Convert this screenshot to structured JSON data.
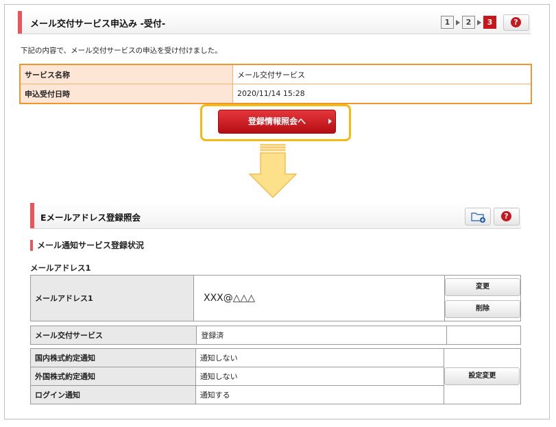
{
  "header": {
    "title": "メール交付サービス申込み -受付-",
    "steps": [
      "1",
      "2",
      "3"
    ],
    "active_step": 3,
    "help_label": "?"
  },
  "intro_text": "下記の内容で、メール交付サービスの申込を受け付けました。",
  "summary": {
    "rows": [
      {
        "label": "サービス名称",
        "value": "メール交付サービス"
      },
      {
        "label": "申込受付日時",
        "value": "2020/11/14 15:28"
      }
    ]
  },
  "cta": {
    "label": "登録情報照会へ"
  },
  "colors": {
    "accent": "#e8565c",
    "brand_red": "#c8161d",
    "highlight": "#f5b914",
    "summary_border": "#f0962e",
    "arrow_fill": "#fde08a"
  },
  "section": {
    "title": "Eメールアドレス登録照会",
    "help_label": "?",
    "sub_title": "メール通知サービス登録状況",
    "mail_header": "メールアドレス1",
    "address": {
      "label": "メールアドレス1",
      "value": "XXX@△△△",
      "change_label": "変更",
      "delete_label": "削除"
    },
    "service": {
      "label": "メール交付サービス",
      "value": "登録済"
    },
    "notifications": [
      {
        "label": "国内株式約定通知",
        "value": "通知しない"
      },
      {
        "label": "外国株式約定通知",
        "value": "通知しない"
      },
      {
        "label": "ログイン通知",
        "value": "通知する"
      }
    ],
    "settings_label": "設定変更"
  }
}
